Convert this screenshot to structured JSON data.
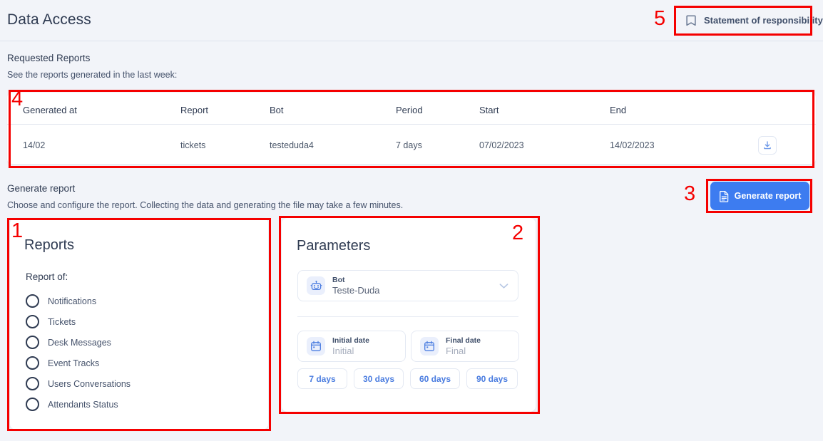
{
  "header": {
    "title": "Data Access",
    "statement_button": {
      "label": "Statement of responsibility",
      "icon": "bookmark-icon"
    }
  },
  "requested_reports": {
    "title": "Requested Reports",
    "subtitle": "See the reports generated in the last week:",
    "columns": [
      "Generated at",
      "Report",
      "Bot",
      "Period",
      "Start",
      "End",
      ""
    ],
    "rows": [
      {
        "generated_at": "14/02",
        "report": "tickets",
        "bot": "testeduda4",
        "period": "7 days",
        "start": "07/02/2023",
        "end": "14/02/2023",
        "download_icon": "download-icon"
      }
    ]
  },
  "generate_section": {
    "title": "Generate report",
    "subtitle": "Choose and configure the report. Collecting the data and generating the file may take a few minutes.",
    "button_label": "Generate report",
    "button_icon": "document-icon",
    "button_color": "#3d7cf0"
  },
  "reports_panel": {
    "heading": "Reports",
    "field_label": "Report of:",
    "options": [
      {
        "label": "Notifications",
        "selected": false
      },
      {
        "label": "Tickets",
        "selected": false
      },
      {
        "label": "Desk Messages",
        "selected": false
      },
      {
        "label": "Event Tracks",
        "selected": false
      },
      {
        "label": "Users Conversations",
        "selected": false
      },
      {
        "label": "Attendants Status",
        "selected": false
      }
    ]
  },
  "parameters_panel": {
    "heading": "Parameters",
    "bot_field": {
      "label": "Bot",
      "value": "Teste-Duda",
      "icon": "robot-icon",
      "chevron": "chevron-down-icon"
    },
    "initial_date": {
      "label": "Initial date",
      "placeholder": "Initial",
      "icon": "calendar-icon"
    },
    "final_date": {
      "label": "Final date",
      "placeholder": "Final",
      "icon": "calendar-icon"
    },
    "quick_ranges": [
      "7 days",
      "30 days",
      "60 days",
      "90 days"
    ]
  },
  "annotations": {
    "markers": [
      "1",
      "2",
      "3",
      "4",
      "5"
    ]
  },
  "colors": {
    "background": "#f2f4f9",
    "accent_blue": "#3d7cf0",
    "annotation_red": "#f50000",
    "text_dark": "#2f3b52"
  }
}
